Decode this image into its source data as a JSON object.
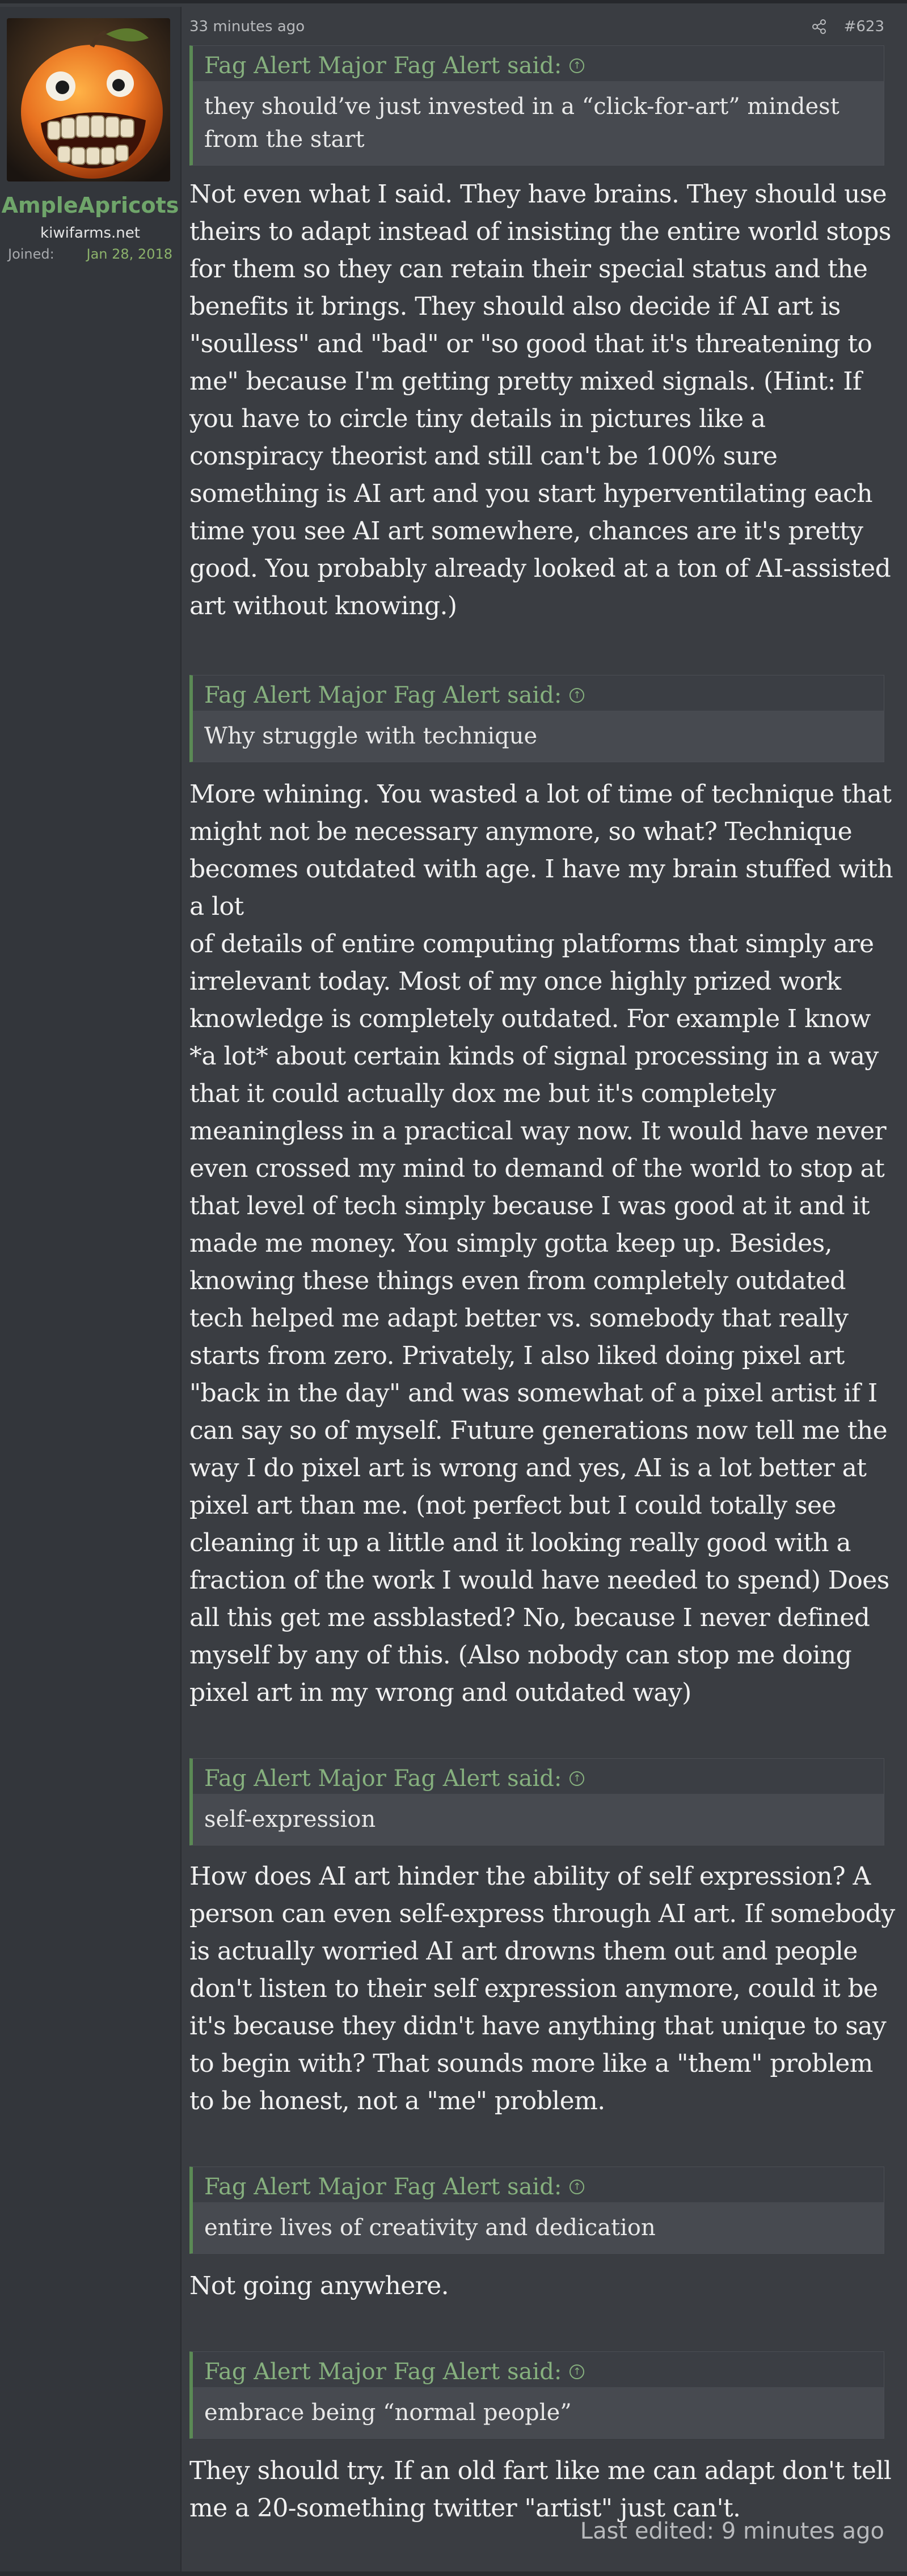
{
  "user": {
    "name": "AmpleApricots",
    "site": "kiwifarms.net",
    "joined_label": "Joined:",
    "joined_value": "Jan 28, 2018",
    "avatar_icon": "apricot-monster-avatar"
  },
  "post": {
    "time": "33 minutes ago",
    "number": "#623",
    "share_icon": "share-icon",
    "last_edited": "Last edited: 9 minutes ago"
  },
  "quotes": [
    {
      "author": "Fag Alert Major Fag Alert said:",
      "text": "they should’ve just invested in a “click-for-art” mindest from the start"
    },
    {
      "author": "Fag Alert Major Fag Alert said:",
      "text": "Why struggle with technique"
    },
    {
      "author": "Fag Alert Major Fag Alert said:",
      "text": "self-expression"
    },
    {
      "author": "Fag Alert Major Fag Alert said:",
      "text": "entire lives of creativity and dedication"
    },
    {
      "author": "Fag Alert Major Fag Alert said:",
      "text": "embrace being “normal people”"
    }
  ],
  "replies": [
    "Not even what I said. They have brains. They should use theirs to adapt instead of insisting the entire world stops for them so they can retain their special status and the benefits it brings. They should also decide if AI art is \"soulless\" and \"bad\" or \"so good that it's threatening to me\" because I'm getting pretty mixed signals. (Hint: If you have to circle tiny details in pictures like a conspiracy theorist and still can't be 100% sure something is AI art and you start hyperventilating each time you see AI art somewhere, chances are it's pretty good. You probably already looked at a ton of AI-assisted art without knowing.)",
    "More whining. You wasted a lot of time of technique that might not be necessary anymore, so what? Technique becomes outdated with age. I have my brain stuffed with a lot\nof details of entire computing platforms that simply are irrelevant today. Most of my once highly prized work knowledge is completely outdated. For example I know *a lot* about certain kinds of signal processing in a way that it could actually dox me but it's completely meaningless in a practical way now. It would have never even crossed my mind to demand of the world to stop at that level of tech simply because I was good at it and it made me money. You simply gotta keep up. Besides, knowing these things even from completely outdated tech helped me adapt better vs. somebody that really starts from zero. Privately, I also liked doing pixel art \"back in the day\" and was somewhat of a pixel artist if I can say so of myself. Future generations now tell me the way I do pixel art is wrong and yes, AI is a lot better at pixel art than me. (not perfect but I could totally see cleaning it up a little and it looking really good with a fraction of the work I would have needed to spend) Does all this get me assblasted? No, because I never defined myself by any of this. (Also nobody can stop me doing pixel art in my wrong and outdated way)",
    "How does AI art hinder the ability of self expression? A person can even self-express through AI art. If somebody is actually worried AI art drowns them out and people don't listen to their self expression anymore, could it be it's because they didn't have anything that unique to say to begin with? That sounds more like a \"them\" problem to be honest, not a \"me\" problem.",
    "Not going anywhere.",
    "They should try. If an old fart like me can adapt don't tell me a 20-something twitter \"artist\" just can't."
  ]
}
